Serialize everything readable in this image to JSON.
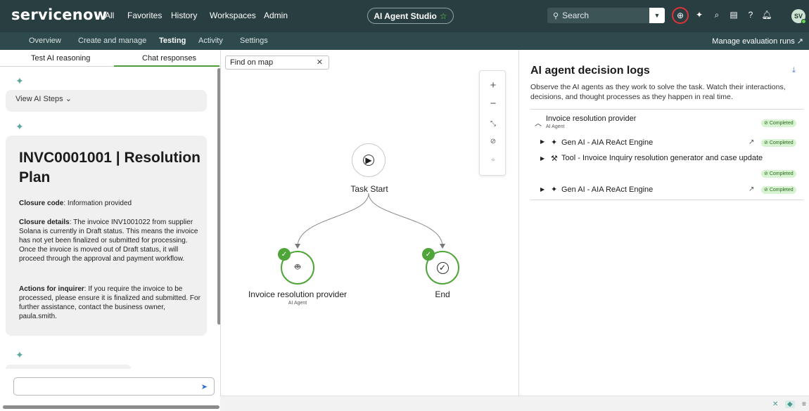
{
  "topbar": {
    "logo": "servicenow",
    "nav": [
      "All",
      "Favorites",
      "History",
      "Workspaces",
      "Admin"
    ],
    "studio_label": "AI Agent Studio",
    "search_placeholder": "Search",
    "avatar_initials": "SV"
  },
  "subnav": {
    "items": [
      "Overview",
      "Create and manage",
      "Testing",
      "Activity",
      "Settings"
    ],
    "active": "Testing",
    "right_link": "Manage evaluation runs"
  },
  "left": {
    "tabs": [
      "Test AI reasoning",
      "Chat responses"
    ],
    "active_tab": "Chat responses",
    "view_steps": "View AI Steps",
    "heading": "INVC0001001 | Resolution Plan",
    "closure_code_label": "Closure code",
    "closure_code": ": Information provided",
    "closure_details_label": "Closure details",
    "closure_details": ": The invoice INV1001022 from supplier Solana is currently in Draft status. This means the invoice has not yet been finalized or submitted for processing. Once the invoice is moved out of Draft status, it will proceed through the approval and payment workflow.",
    "actions_label": "Actions for inquirer",
    "actions": ": If you require the invoice to be processed, please ensure it is finalized and submitted. For further assistance, contact the business owner, paula.smith."
  },
  "center": {
    "find_placeholder": "Find on map",
    "nodes": {
      "start": "Task Start",
      "provider": "Invoice resolution provider",
      "provider_sub": "AI Agent",
      "end": "End"
    }
  },
  "right": {
    "title": "AI agent decision logs",
    "description": "Observe the AI agents as they work to solve the task. Watch their interactions, decisions, and thought processes as they happen in real time.",
    "group_title": "Invoice resolution provider",
    "group_sub": "AI Agent",
    "status": "Completed",
    "rows": [
      "Gen AI - AIA ReAct Engine",
      "Tool - Invoice Inquiry resolution generator and case update",
      "Gen AI - AIA ReAct Engine"
    ]
  },
  "colors": {
    "topbar": "#293e40",
    "subnav": "#2e4a4d",
    "accent_green": "#4fa53a",
    "alert_red": "#e0323a"
  },
  "icons": [
    "sparkle-icon",
    "search-icon",
    "globe-icon",
    "play-icon",
    "robot-icon",
    "check-circle-icon",
    "send-icon",
    "download-icon",
    "external-link-icon"
  ]
}
